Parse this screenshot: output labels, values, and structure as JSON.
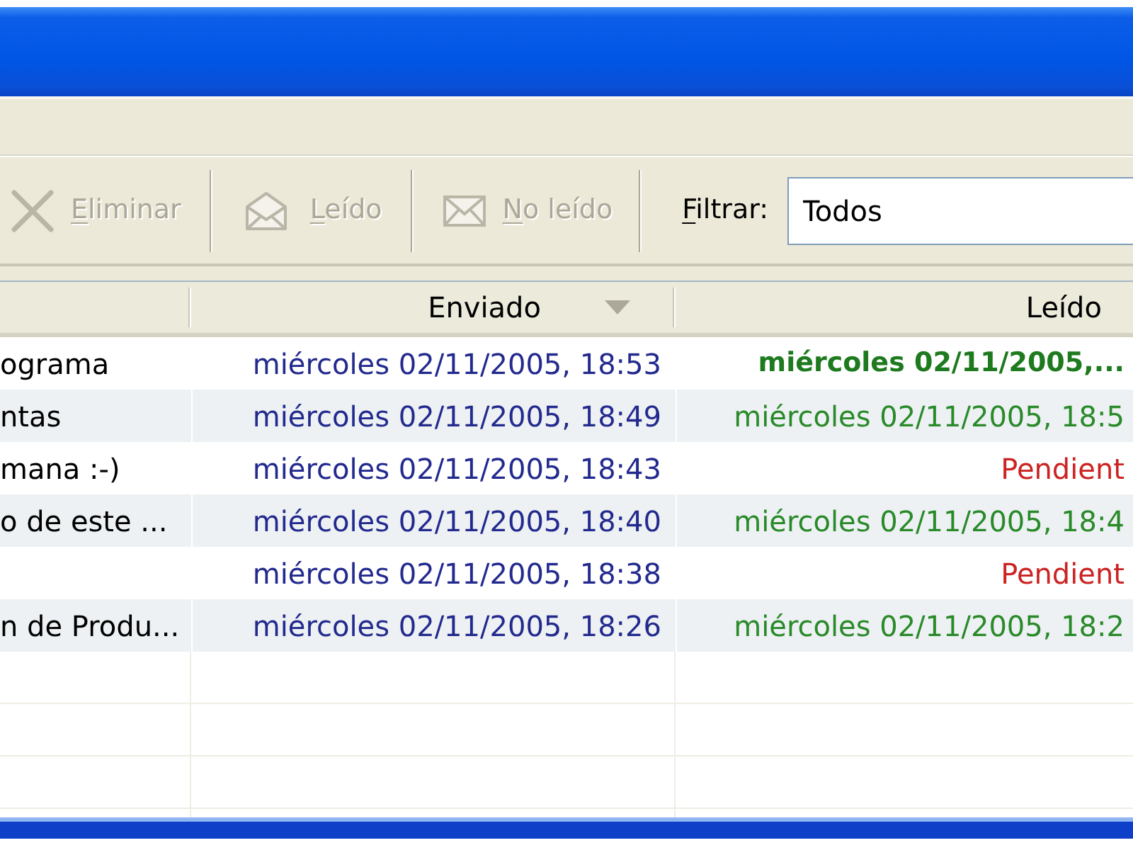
{
  "toolbar": {
    "buttons": [
      {
        "kind": "delete",
        "label": "Eliminar",
        "disabled": true,
        "mnemonic_underlined": true
      },
      {
        "kind": "mark_read",
        "label": "Leído",
        "disabled": true,
        "mnemonic_underlined": true
      },
      {
        "kind": "mark_unread",
        "label": "No leído",
        "disabled": true,
        "mnemonic_underlined": true
      }
    ],
    "filter": {
      "label": "Filtrar:",
      "mnemonic_underlined": true,
      "value": "Todos"
    }
  },
  "table": {
    "columns": [
      {
        "label": "Enviado",
        "sorted_descending": true
      },
      {
        "label": "Leído",
        "sorted_descending": false
      }
    ],
    "rows": [
      {
        "column_1": "ograma",
        "sent": "miércoles 02/11/2005, 18:53",
        "read": {
          "text": "miércoles 02/11/2005,...",
          "pending": false,
          "bold": true
        }
      },
      {
        "column_1": "ntas",
        "sent": "miércoles 02/11/2005, 18:49",
        "read": {
          "text": "miércoles 02/11/2005, 18:5",
          "pending": false,
          "bold": false
        }
      },
      {
        "column_1": "mana :-)",
        "sent": "miércoles 02/11/2005, 18:43",
        "read": {
          "text": "Pendient",
          "pending": true,
          "bold": false
        }
      },
      {
        "column_1": "o de este ...",
        "sent": "miércoles 02/11/2005, 18:40",
        "read": {
          "text": "miércoles 02/11/2005, 18:4",
          "pending": false,
          "bold": false
        }
      },
      {
        "sent": "miércoles 02/11/2005, 18:38",
        "read": {
          "text": "Pendient",
          "pending": true,
          "bold": false
        }
      },
      {
        "column_1": "n de Produ...",
        "sent": "miércoles 02/11/2005, 18:26",
        "read": {
          "text": "miércoles 02/11/2005, 18:2",
          "pending": false,
          "bold": false
        }
      }
    ]
  }
}
